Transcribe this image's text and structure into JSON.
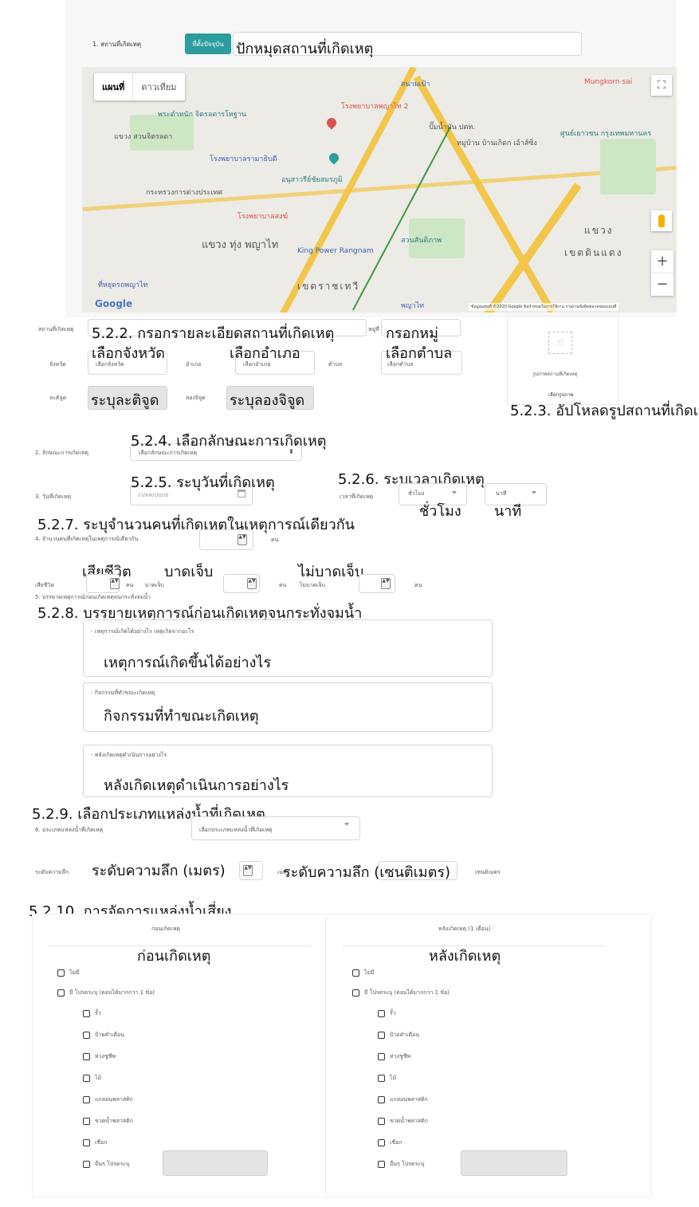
{
  "section1": {
    "label": "1. สถานที่เกิดเหตุ",
    "current_location_button": "ที่ตั้งปัจจุบัน",
    "pin_annotation": "ปักหมุดสถานที่เกิดเหตุ"
  },
  "map": {
    "type_map": "แผนที่",
    "type_satellite": "ดาวเทียม",
    "google_logo": "Google",
    "footer": "ข้อมูลแผนที่ ©2020 Google   ข้อกำหนดในการใช้งาน   รายงานข้อผิดพลาดของแผนที่",
    "zoom_in": "+",
    "zoom_out": "−",
    "fullscreen": "⛶",
    "labels": {
      "l1": "สนามเป้า",
      "l2": "โรงพยาบาลพญาไท 2",
      "l3": "พระตำหนัก จิตรลดารโหฐาน",
      "l4": "แขวง สวนจิตรลดา",
      "l5": "ปั๊มน้ำมัน ปตท.",
      "l6": "หมู่บ้าน บ้านเกิดก เอ้าส์ซิ่ง",
      "l7": "ศูนย์เยาวชน กรุงเทพมหานคร",
      "l8": "โรงพยาบาลรามาธิบดี",
      "l9": "อนุสาวรีย์ชัยสมรภูมิ",
      "l10": "กระทรวงการต่างประเทศ",
      "l11": "โรงพยาบาลสงฆ์",
      "l12": "แขวง ทุ่ง พญาไท",
      "l13": "King Power Rangnam",
      "l14": "สวนสันติภาพ",
      "l15": "เขตดินแดง",
      "l16": "เขตราชเทวี",
      "l17": "ที่หยุดรถพญาไท",
      "l18": "Mungkorn sai",
      "l19": "แขวง",
      "l20": "พญาไท"
    }
  },
  "address": {
    "place_label": "สถานที่เกิดเหตุ",
    "place_annotation": "5.2.2. กรอกรายละเอียดสถานที่เกิดเหตุ",
    "moo_label": "หมู่ที่",
    "moo_annotation": "กรอกหมู่",
    "province_label": "จังหวัด",
    "province_placeholder": "เลือกจังหวัด",
    "province_annotation": "เลือกจังหวัด",
    "district_label": "อำเภอ",
    "district_placeholder": "เลือกอำเภอ",
    "district_annotation": "เลือกอำเภอ",
    "subdistrict_label": "ตำบล",
    "subdistrict_placeholder": "เลือกตำบล",
    "subdistrict_annotation": "เลือกตำบล",
    "lat_label": "ละติจูด",
    "lat_annotation": "ระบุละติจูด",
    "lng_label": "ลองจิจูด",
    "lng_annotation": "ระบุลองจิจูด",
    "photo_caption": "รูปภาพสถานที่เกิดเหตุ",
    "photo_button": "เลือกรูปภาพ",
    "photo_annotation": "5.2.3. อัปโหลดรูปสถานที่เกิดเหตุ"
  },
  "section2": {
    "label": "2. ลักษณะการเกิดเหตุ",
    "placeholder": "เลือกลักษณะการเกิดเหตุ",
    "annotation": "5.2.4. เลือกลักษณะการเกิดเหตุ"
  },
  "section3": {
    "label": "3. วันที่เกิดเหตุ",
    "date_placeholder": "วว/ดด/ปปปป",
    "date_annotation": "5.2.5. ระบุวันที่เกิดเหตุ",
    "time_label": "เวลาที่เกิดเหตุ",
    "time_annotation": "5.2.6. ระบุเวลาเกิดเหตุ",
    "hour_placeholder": "ชั่วโมง",
    "hour_annotation": "ชั่วโมง",
    "minute_placeholder": "นาที",
    "minute_annotation": "นาที"
  },
  "section4": {
    "label": "4. จำนวนคนที่เกิดเหตุในเหตุการณ์เดียวกัน",
    "annotation": "5.2.7. ระบุจำนวนคนที่เกิดเหตุในเหตุการณ์เดียวกัน",
    "unit": "คน",
    "dead_label": "เสียชีวิต",
    "dead_annotation": "เสียชีวิต",
    "injured_label": "บาดเจ็บ",
    "injured_annotation": "บาดเจ็บ",
    "uninjured_label": "ไม่บาดเจ็บ",
    "uninjured_annotation": "ไม่บาดเจ็บ"
  },
  "section5": {
    "label": "5. บรรยายเหตุการณ์ก่อนเกิดเหตุจนกระทั่งจมน้ำ",
    "annotation": "5.2.8. บรรยายเหตุการณ์ก่อนเกิดเหตุจนกระทั่งจมน้ำ",
    "box1_label": "- เหตุการณ์เกิดได้อย่างไร เหตุเกิดจากอะไร",
    "box1_annotation": "เหตุการณ์เกิดขึ้นได้อย่างไร",
    "box2_label": "- กิจกรรมที่ทำขณะเกิดเหตุ",
    "box2_annotation": "กิจกรรมที่ทำขณะเกิดเหตุ",
    "box3_label": "- หลังเกิดเหตุดำเนินการอย่างไร",
    "box3_annotation": "หลังเกิดเหตุดำเนินการอย่างไร"
  },
  "section6": {
    "label": "6. ประเภทแหล่งน้ำที่เกิดเหตุ",
    "placeholder": "เลือกประเภทแหล่งน้ำที่เกิดเหตุ",
    "annotation": "5.2.9. เลือกประเภทแหล่งน้ำที่เกิดเหตุ",
    "depth_label": "ระดับความลึก",
    "depth_m_annotation": "ระดับความลึก (เมตร)",
    "unit_m": "เมตร",
    "depth_cm_annotation": "ระดับความลึก (เซนติเมตร)",
    "unit_cm": "เซนติเมตร"
  },
  "section7": {
    "annotation": "5.2.10. การจัดการแหล่งน้ำเสี่ยง",
    "before_header": "ก่อนเกิดเหตุ",
    "before_annotation": "ก่อนเกิดเหตุ",
    "after_header": "หลังเกิดเหตุ (1 เดือน)",
    "after_annotation": "หลังเกิดเหตุ",
    "options": {
      "none": "ไม่มี",
      "has": "มี โปรดระบุ (ตอบได้มากกว่า 1 ข้อ)",
      "fence": "รั้ว",
      "sign": "ป้ายคำเตือน",
      "buoy": "ห่วงชูชีพ",
      "stick": "ไม้",
      "gallon": "แกลอนพลาสติก",
      "bottle": "ขวดน้ำพลาสติก",
      "rope": "เชือก",
      "other": "อื่นๆ โปรดระบุ"
    }
  },
  "colors": {
    "teal_button": "#2a9d9c",
    "road_yellow": "#f2c64a",
    "map_bg": "#ecebe6"
  }
}
